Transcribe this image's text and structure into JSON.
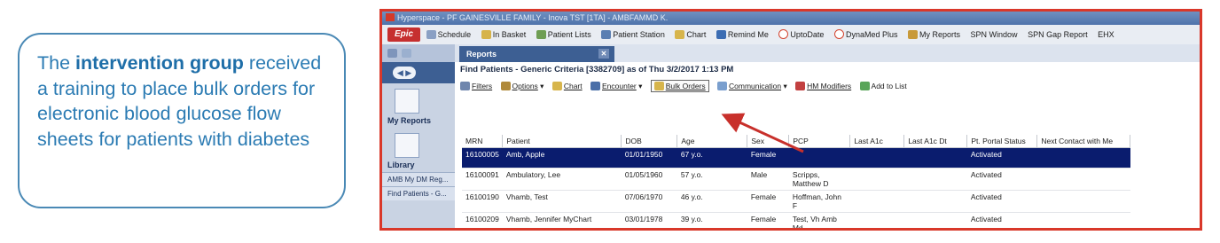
{
  "callout": {
    "prefix": "The ",
    "bold": "intervention group",
    "rest": " received a training to place bulk orders for electronic blood glucose flow sheets for patients with diabetes"
  },
  "window": {
    "title": "Hyperspace - PF GAINESVILLE FAMILY - Inova TST [1TA] - AMBFAMMD K."
  },
  "menubar": {
    "logo": "Epic",
    "items": [
      "Schedule",
      "In Basket",
      "Patient Lists",
      "Patient Station",
      "Chart",
      "Remind Me",
      "UptoDate",
      "DynaMed Plus",
      "My Reports",
      "SPN Window",
      "SPN Gap Report",
      "EHX"
    ]
  },
  "leftpanel": {
    "top_label": "Reports",
    "my_reports": "My Reports",
    "library": "Library",
    "item1": "AMB My DM Reg...",
    "item2": "Find Patients - G..."
  },
  "tab": {
    "label": "Reports",
    "close": "✕"
  },
  "report": {
    "title": "Find Patients - Generic Criteria [3382709] as of Thu 3/2/2017  1:13 PM"
  },
  "toolbar": {
    "filters": "Filters",
    "options": "Options",
    "chart": "Chart",
    "encounter": "Encounter",
    "bulk_orders": "Bulk Orders",
    "communication": "Communication",
    "hm_modifiers": "HM Modifiers",
    "add_to_list": "Add to List"
  },
  "table": {
    "headers": [
      "MRN",
      "Patient",
      "DOB",
      "Age",
      "Sex",
      "PCP",
      "Last A1c",
      "Last A1c Dt",
      "Pt. Portal Status",
      "Next Contact with Me"
    ],
    "rows": [
      [
        "16100005",
        "Amb, Apple",
        "01/01/1950",
        "67 y.o.",
        "Female",
        "",
        "",
        "",
        "Activated",
        ""
      ],
      [
        "16100091",
        "Ambulatory, Lee",
        "01/05/1960",
        "57 y.o.",
        "Male",
        "Scripps, Matthew D",
        "",
        "",
        "Activated",
        ""
      ],
      [
        "16100190",
        "Vhamb, Test",
        "07/06/1970",
        "46 y.o.",
        "Female",
        "Hoffman, John F",
        "",
        "",
        "Activated",
        ""
      ],
      [
        "16100209",
        "Vhamb, Jennifer MyChart",
        "03/01/1978",
        "39 y.o.",
        "Female",
        "Test, Vh Amb Md",
        "",
        "",
        "Activated",
        ""
      ]
    ]
  },
  "colors": {
    "callout_text": "#2b7bb3",
    "callout_border": "#4a89b5",
    "frame_border": "#d9382a",
    "selected_row": "#0a1c6e",
    "arrow": "#c8302b"
  }
}
